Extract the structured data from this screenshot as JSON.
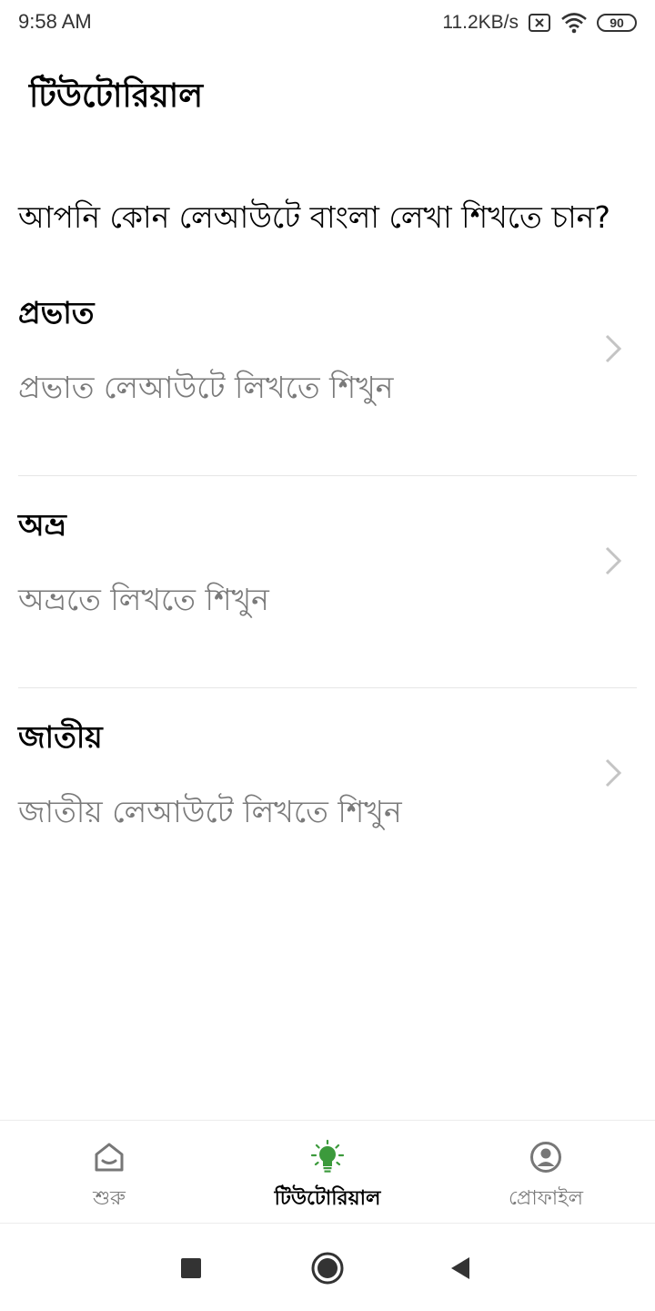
{
  "status_bar": {
    "time": "9:58 AM",
    "net_speed": "11.2KB/s",
    "battery_level": "90",
    "icons": [
      "sim-none-icon",
      "wifi-icon",
      "battery-icon"
    ]
  },
  "header": {
    "title": "টিউটোরিয়াল"
  },
  "main": {
    "question": "আপনি কোন লেআউটে বাংলা লেখা শিখতে চান?",
    "layouts": [
      {
        "title": "প্রভাত",
        "description": "প্রভাত লেআউটে লিখতে শিখুন"
      },
      {
        "title": "অভ্র",
        "description": "অভ্রতে লিখতে শিখুন"
      },
      {
        "title": "জাতীয়",
        "description": "জাতীয় লেআউটে লিখতে শিখুন"
      }
    ]
  },
  "bottom_nav": {
    "items": [
      {
        "label": "শুরু",
        "icon": "home-icon",
        "active": false
      },
      {
        "label": "টিউটোরিয়াল",
        "icon": "lightbulb-icon",
        "active": true
      },
      {
        "label": "প্রোফাইল",
        "icon": "profile-icon",
        "active": false
      }
    ],
    "active_color": "#3c9a3c",
    "inactive_color": "#7a7a7a"
  },
  "system_nav": {
    "icons": [
      "recents-square-icon",
      "home-circle-icon",
      "back-triangle-icon"
    ]
  }
}
